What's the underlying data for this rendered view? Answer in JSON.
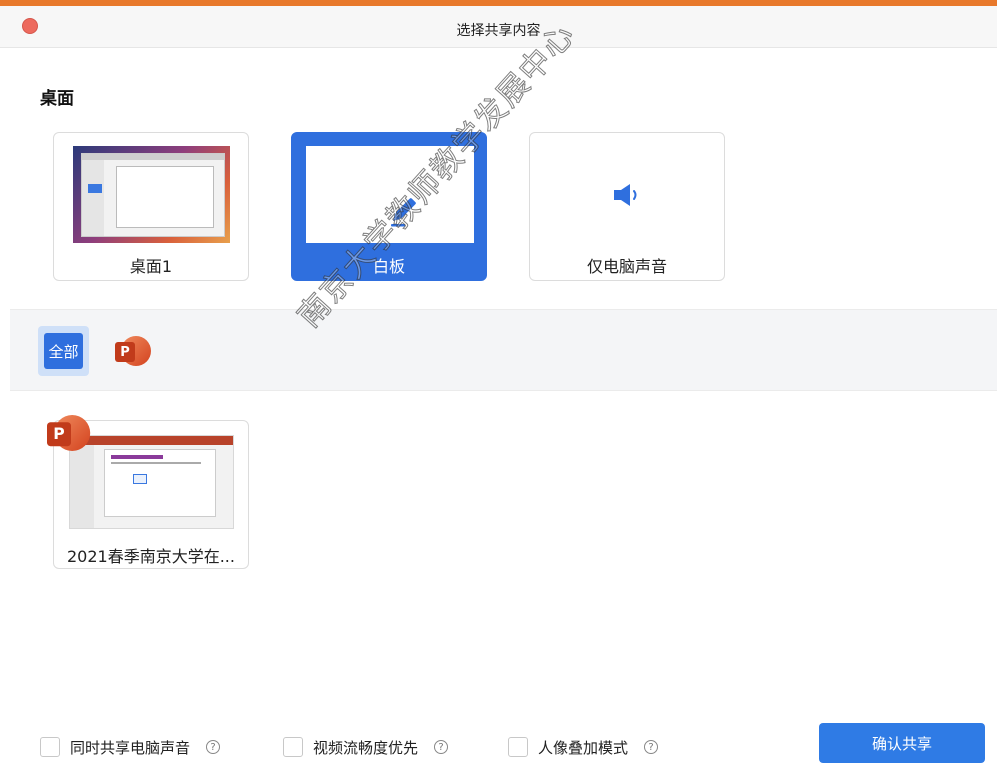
{
  "window": {
    "title": "选择共享内容"
  },
  "desktop_section": {
    "label": "桌面",
    "cards": [
      {
        "label": "桌面1",
        "selected": false
      },
      {
        "label": "白板",
        "selected": true
      },
      {
        "label": "仅电脑声音",
        "selected": false
      }
    ]
  },
  "filters": {
    "all_label": "全部",
    "app_icon": "powerpoint-icon"
  },
  "windows": [
    {
      "label": "2021春季南京大学在...",
      "app_icon": "powerpoint-icon"
    }
  ],
  "options": [
    {
      "label": "同时共享电脑声音",
      "checked": false
    },
    {
      "label": "视频流畅度优先",
      "checked": false
    },
    {
      "label": "人像叠加模式",
      "checked": false
    }
  ],
  "help_glyph": "?",
  "confirm_label": "确认共享",
  "watermark_text": "南京大学教师教学发展中心",
  "ppt_letter": "P",
  "colors": {
    "accent": "#2f6fde",
    "confirm": "#2f7be5",
    "top_bar": "#e8792b"
  }
}
